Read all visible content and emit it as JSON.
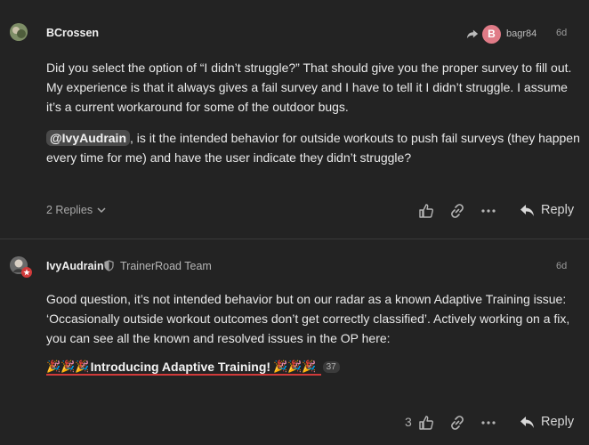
{
  "post1": {
    "username": "BCrossen",
    "date": "6d",
    "reply_to": {
      "avatar_letter": "B",
      "name": "bagr84"
    },
    "paragraph1": "Did you select the option of “I didn’t struggle?” That should give you the proper survey to fill out. My experience is that it always gives a fail survey and I have to tell it I didn’t struggle. I assume it’s a current workaround for some of the outdoor bugs.",
    "mention": "@IvyAudrain",
    "paragraph2_rest": ", is it the intended behavior for outside workouts to push fail surveys (they happen every time for me) and have the user indicate they didn’t struggle?",
    "replies_label": "2 Replies",
    "reply_label": "Reply"
  },
  "post2": {
    "username": "IvyAudrain",
    "flair": "TrainerRoad Team",
    "date": "6d",
    "paragraph": "Good question, it’s not intended behavior but on our radar as a known Adaptive Training issue: ‘Occasionally outside workout outcomes don’t get correctly classified’. Actively working on a fix, you can see all the known and resolved issues in the OP here:",
    "link_emoji_left": "🎉🎉🎉",
    "link_text": "Introducing Adaptive Training!",
    "link_emoji_right": "🎉🎉🎉",
    "link_clicks": "37",
    "like_count": "3",
    "reply_label": "Reply"
  },
  "colors": {
    "background": "#232323",
    "mention_bg": "#4a4a4a",
    "avatar_b": "#e07b87",
    "link_underline": "#d13a3a"
  }
}
